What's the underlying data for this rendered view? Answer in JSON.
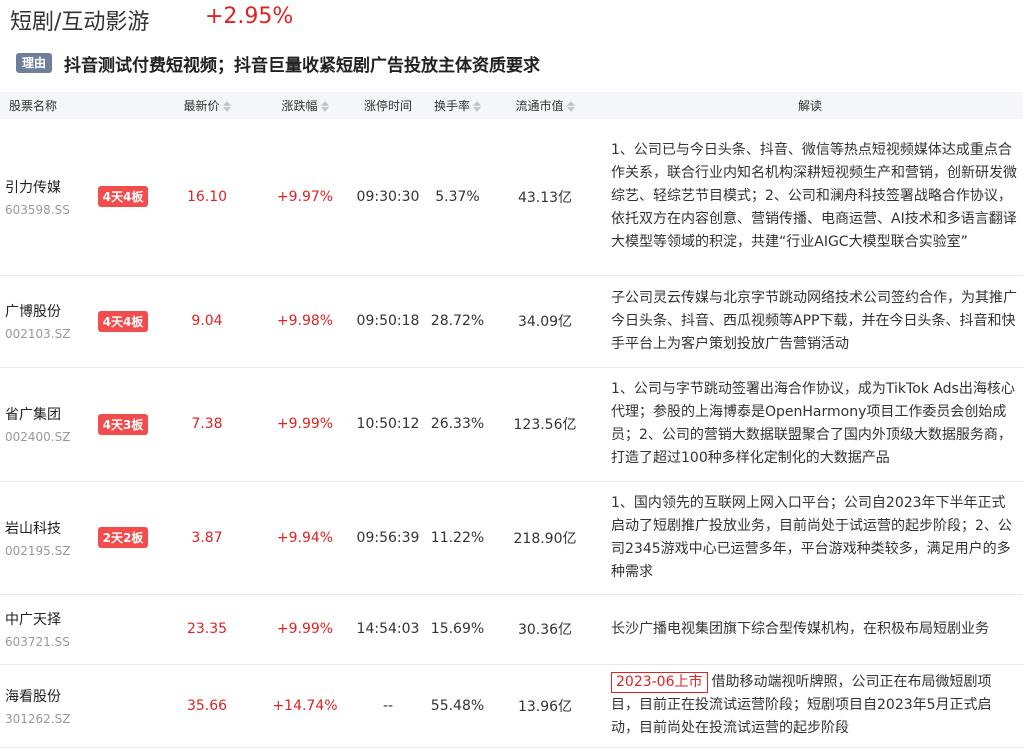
{
  "header": {
    "sector_name": "短剧/互动影游",
    "sector_change": "+2.95%",
    "reason_tag": "理由",
    "reason_text": "抖音测试付费短视频；抖音巨量收紧短剧广告投放主体资质要求"
  },
  "columns": [
    "股票名称",
    "最新价",
    "涨跌幅",
    "涨停时间",
    "换手率",
    "流通市值",
    "解读"
  ],
  "rows": [
    {
      "name": "引力传媒",
      "code": "603598.SS",
      "board": "4天4板",
      "price": "16.10",
      "change": "+9.97%",
      "limit_time": "09:30:30",
      "turnover": "5.37%",
      "market_cap": "43.13亿",
      "ipo_tag": "",
      "desc": "1、公司已与今日头条、抖音、微信等热点短视频媒体达成重点合作关系，联合行业内知名机构深耕短视频生产和营销，创新研发微综艺、轻综艺节目模式；2、公司和澜舟科技签署战略合作协议，依托双方在内容创意、营销传播、电商运营、AI技术和多语言翻译大模型等领域的积淀，共建“行业AIGC大模型联合实验室”"
    },
    {
      "name": "广博股份",
      "code": "002103.SZ",
      "board": "4天4板",
      "price": "9.04",
      "change": "+9.98%",
      "limit_time": "09:50:18",
      "turnover": "28.72%",
      "market_cap": "34.09亿",
      "ipo_tag": "",
      "desc": "子公司灵云传媒与北京字节跳动网络技术公司签约合作，为其推广今日头条、抖音、西瓜视频等APP下载，并在今日头条、抖音和快手平台上为客户策划投放广告营销活动"
    },
    {
      "name": "省广集团",
      "code": "002400.SZ",
      "board": "4天3板",
      "price": "7.38",
      "change": "+9.99%",
      "limit_time": "10:50:12",
      "turnover": "26.33%",
      "market_cap": "123.56亿",
      "ipo_tag": "",
      "desc": "1、公司与字节跳动签署出海合作协议，成为TikTok Ads出海核心代理；参股的上海博泰是OpenHarmony项目工作委员会创始成员；2、公司的营销大数据联盟聚合了国内外顶级大数据服务商，打造了超过100种多样化定制化的大数据产品"
    },
    {
      "name": "岩山科技",
      "code": "002195.SZ",
      "board": "2天2板",
      "price": "3.87",
      "change": "+9.94%",
      "limit_time": "09:56:39",
      "turnover": "11.22%",
      "market_cap": "218.90亿",
      "ipo_tag": "",
      "desc": "1、国内领先的互联网上网入口平台；公司自2023年下半年正式启动了短剧推广投放业务，目前尚处于试运营的起步阶段；2、公司2345游戏中心已运营多年，平台游戏种类较多，满足用户的多种需求"
    },
    {
      "name": "中广天择",
      "code": "603721.SS",
      "board": "",
      "price": "23.35",
      "change": "+9.99%",
      "limit_time": "14:54:03",
      "turnover": "15.69%",
      "market_cap": "30.36亿",
      "ipo_tag": "",
      "desc": "长沙广播电视集团旗下综合型传媒机构，在积极布局短剧业务"
    },
    {
      "name": "海看股份",
      "code": "301262.SZ",
      "board": "",
      "price": "35.66",
      "change": "+14.74%",
      "limit_time": "--",
      "turnover": "55.48%",
      "market_cap": "13.96亿",
      "ipo_tag": "2023-06上市",
      "desc": "借助移动端视听牌照，公司正在布局微短剧项目，目前正在投流试运营阶段；短剧项目自2023年5月正式启动，目前尚处在投流试运营的起步阶段"
    }
  ]
}
